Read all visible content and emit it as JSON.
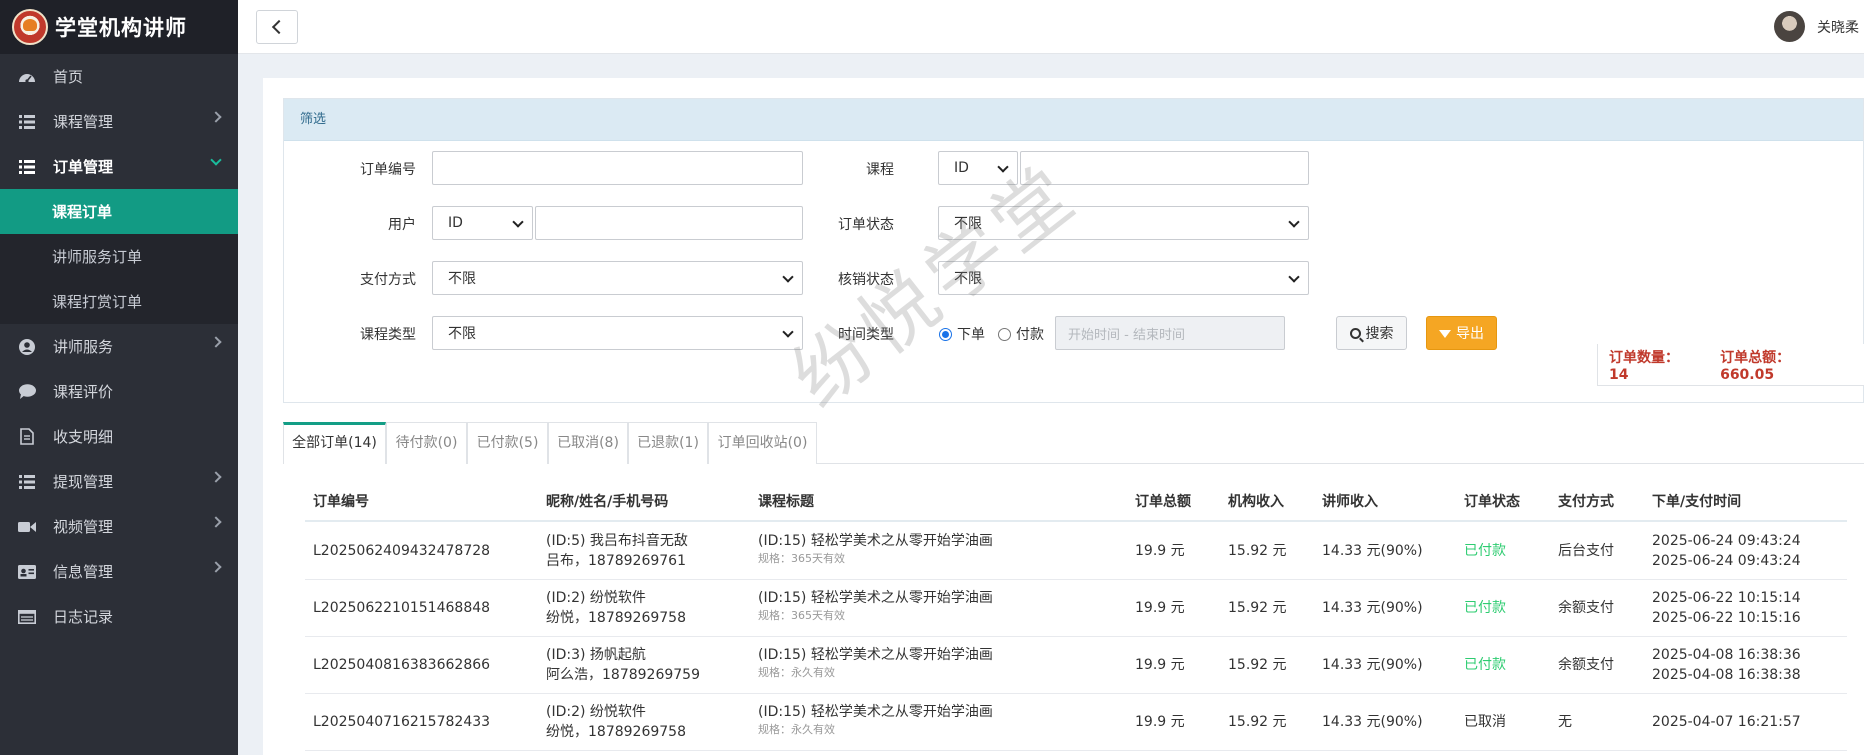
{
  "brand": {
    "title": "学堂机构讲师",
    "logo_icon": "school-logo"
  },
  "sidebar": {
    "items": [
      {
        "label": "首页",
        "icon": "dashboard-icon"
      },
      {
        "label": "课程管理",
        "icon": "list-icon"
      },
      {
        "label": "订单管理",
        "icon": "list-icon"
      },
      {
        "label": "讲师服务",
        "icon": "user-circle-icon"
      },
      {
        "label": "课程评价",
        "icon": "comment-icon"
      },
      {
        "label": "收支明细",
        "icon": "document-icon"
      },
      {
        "label": "提现管理",
        "icon": "list-icon"
      },
      {
        "label": "视频管理",
        "icon": "video-icon"
      },
      {
        "label": "信息管理",
        "icon": "id-card-icon"
      },
      {
        "label": "日志记录",
        "icon": "log-icon"
      }
    ],
    "submenu": [
      {
        "label": "课程订单",
        "active": true
      },
      {
        "label": "讲师服务订单"
      },
      {
        "label": "课程打赏订单"
      }
    ]
  },
  "topbar": {
    "user_name": "关晓柔"
  },
  "filter": {
    "header": "筛选",
    "order_no_label": "订单编号",
    "course_label": "课程",
    "course_select": "ID",
    "user_label": "用户",
    "user_select": "ID",
    "order_status_label": "订单状态",
    "order_status_value": "不限",
    "pay_method_label": "支付方式",
    "pay_method_value": "不限",
    "verify_status_label": "核销状态",
    "verify_status_value": "不限",
    "course_type_label": "课程类型",
    "course_type_value": "不限",
    "time_type_label": "时间类型",
    "time_option_order": "下单",
    "time_option_pay": "付款",
    "time_range_placeholder": "开始时间 - 结束时间",
    "search_label": "搜索",
    "export_label": "导出"
  },
  "tabs": [
    {
      "label": "全部订单(14)",
      "active": true
    },
    {
      "label": "待付款(0)"
    },
    {
      "label": "已付款(5)"
    },
    {
      "label": "已取消(8)"
    },
    {
      "label": "已退款(1)"
    },
    {
      "label": "订单回收站(0)"
    }
  ],
  "summary": {
    "count": "订单数量：14",
    "total": "订单总额：660.05"
  },
  "table": {
    "headers": [
      "订单编号",
      "昵称/姓名/手机号码",
      "课程标题",
      "订单总额",
      "机构收入",
      "讲师收入",
      "订单状态",
      "支付方式",
      "下单/支付时间"
    ],
    "rows": [
      {
        "order_no": "L2025062409432478728",
        "user_line1": "(ID:5) 我吕布抖音无敌",
        "user_line2": "吕布，18789269761",
        "course": "(ID:15) 轻松学美术之从零开始学油画",
        "spec": "规格：365天有效",
        "total": "19.9 元",
        "org_income": "15.92 元",
        "teacher_income": "14.33 元(90%)",
        "status": "已付款",
        "status_paid": true,
        "pay_method": "后台支付",
        "time1": "2025-06-24 09:43:24",
        "time2": "2025-06-24 09:43:24"
      },
      {
        "order_no": "L2025062210151468848",
        "user_line1": "(ID:2) 纷悦软件",
        "user_line2": "纷悦，18789269758",
        "course": "(ID:15) 轻松学美术之从零开始学油画",
        "spec": "规格：365天有效",
        "total": "19.9 元",
        "org_income": "15.92 元",
        "teacher_income": "14.33 元(90%)",
        "status": "已付款",
        "status_paid": true,
        "pay_method": "余额支付",
        "time1": "2025-06-22 10:15:14",
        "time2": "2025-06-22 10:15:16"
      },
      {
        "order_no": "L2025040816383662866",
        "user_line1": "(ID:3) 扬帆起航",
        "user_line2": "阿么浩，18789269759",
        "course": "(ID:15) 轻松学美术之从零开始学油画",
        "spec": "规格：永久有效",
        "total": "19.9 元",
        "org_income": "15.92 元",
        "teacher_income": "14.33 元(90%)",
        "status": "已付款",
        "status_paid": true,
        "pay_method": "余额支付",
        "time1": "2025-04-08 16:38:36",
        "time2": "2025-04-08 16:38:38"
      },
      {
        "order_no": "L2025040716215782433",
        "user_line1": "(ID:2) 纷悦软件",
        "user_line2": "纷悦，18789269758",
        "course": "(ID:15) 轻松学美术之从零开始学油画",
        "spec": "规格：永久有效",
        "total": "19.9 元",
        "org_income": "15.92 元",
        "teacher_income": "14.33 元(90%)",
        "status": "已取消",
        "status_paid": false,
        "pay_method": "无",
        "time1": "2025-04-07 16:21:57",
        "time2": ""
      }
    ]
  },
  "watermark": "纷悦学堂",
  "colors": {
    "sidebar_bg": "#2c2f37",
    "active_menu": "#129b84",
    "paid_status": "#2ecc71",
    "summary_text": "#c0392b",
    "export_button": "#f5a623"
  }
}
